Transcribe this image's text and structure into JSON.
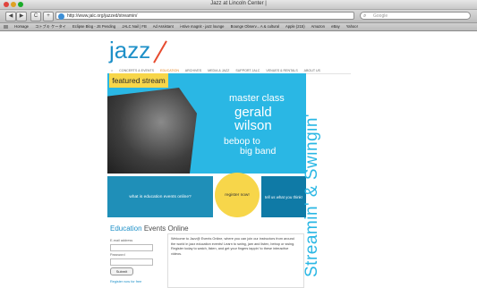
{
  "window": {
    "title": "Jazz at Lincoln Center |"
  },
  "toolbar": {
    "back_label": "◀",
    "forward_label": "▶",
    "reload_label": "C",
    "add_label": "+",
    "url": "http://www.jalc.org/jazzed/streamin/",
    "search_placeholder": "Google"
  },
  "bookmarks": [
    "Homage",
    "コトブキ ケータイ",
    "Eclipse Blog - JS Pending",
    "JALC Nail | FB",
    "Ad Assistant",
    "i-stive magnit - jazz lounge",
    "Bounge Observ... A & cultural",
    "Apple (215)",
    "Amazon",
    "eBay",
    "Yahoo!"
  ],
  "site": {
    "logo": "jazz",
    "nav": [
      "CONCERTS & EVENTS",
      "EDUCATION",
      "ARCHIVES",
      "MEDIA & JAZZ",
      "SUPPORT JALC",
      "VENUES & RENTALS",
      "ABOUT US"
    ],
    "featured_label": "featured stream",
    "hero_lines": [
      "master class",
      "gerald",
      "wilson",
      "bebop to",
      "big band"
    ],
    "promo1": "what is education events online?",
    "promo2": "register now!",
    "promo3": "tell us what you think!",
    "vertical_text": "Streamin' & Swingin'",
    "section_title_blue": "Education",
    "section_title_dark": "Events Online",
    "email_label": "E-mail address",
    "password_label": "Password",
    "submit_label": "Submit",
    "register_link": "Register now for free",
    "welcome": "Welcome to Jazz@ Events Online, where you can join our instructors from around the world in jazz education events! Learn to swing, jam and listen, bebop or swing. Register today to watch, listen, and get your fingers tappin' to these interactive videos."
  },
  "colors": {
    "accent": "#2ab7e4",
    "yellow": "#f7d64a",
    "logo_slash": "#e74b2f"
  }
}
